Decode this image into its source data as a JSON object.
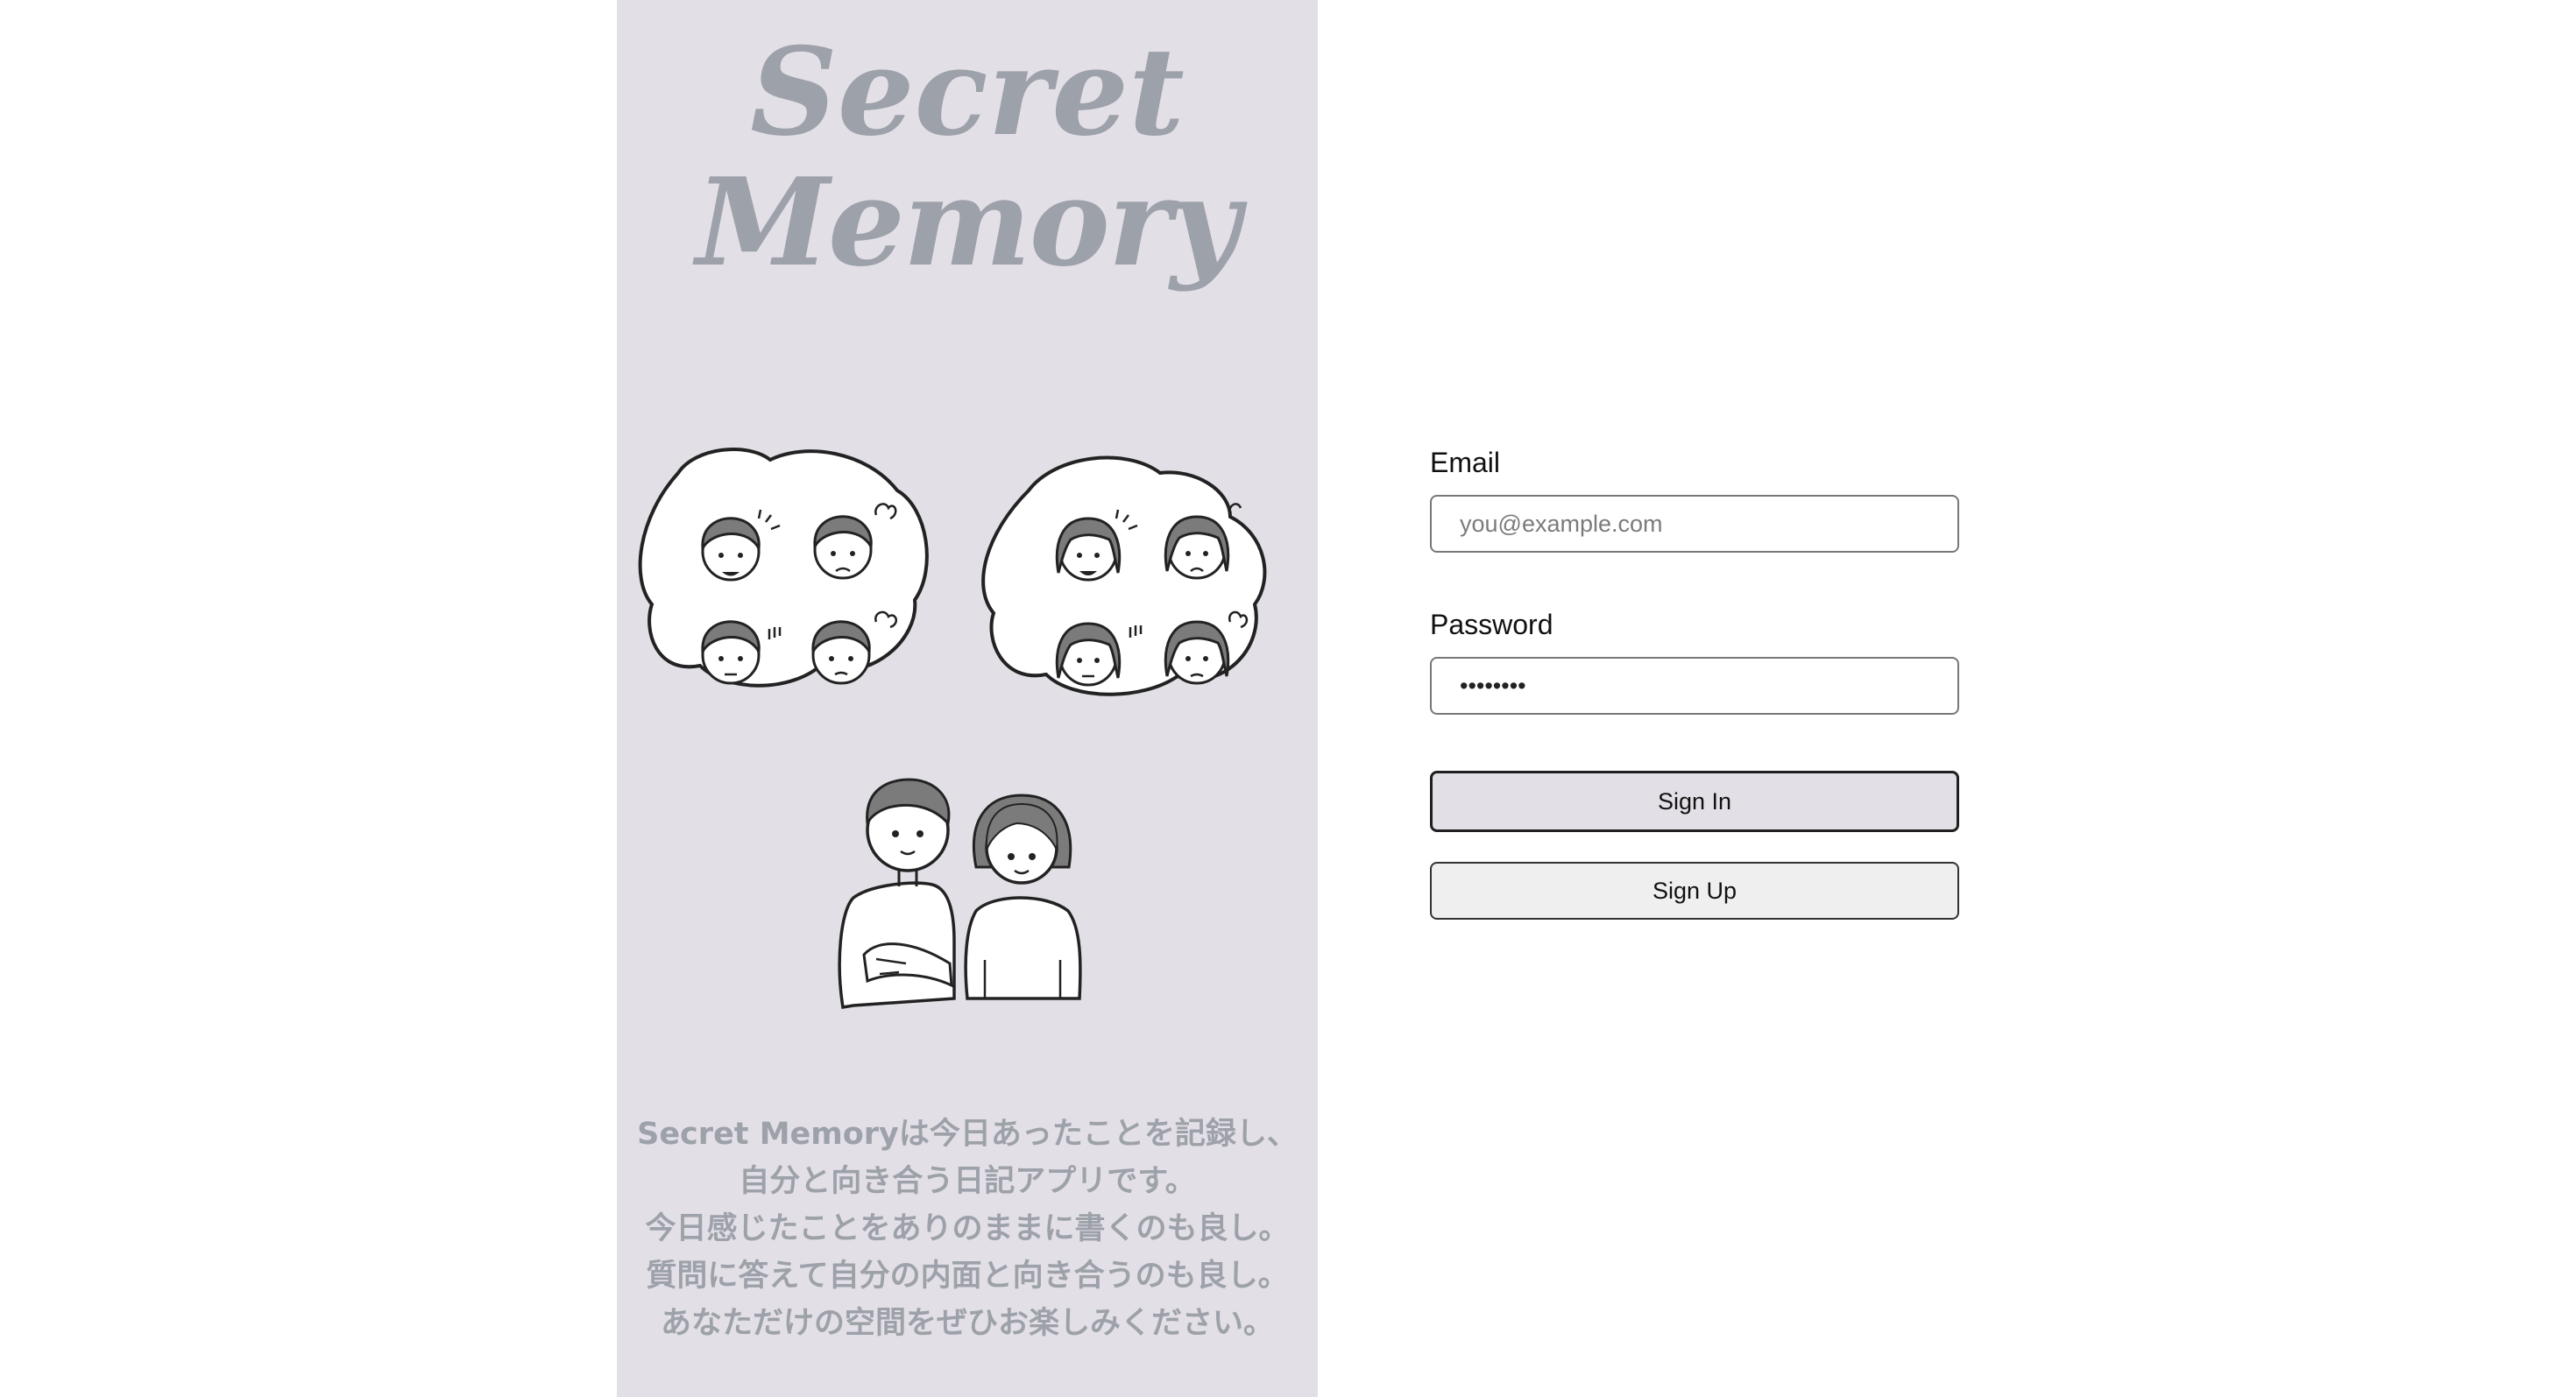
{
  "brand": {
    "title_line1": "Secret",
    "title_line2": "Memory",
    "panel_color": "#e3dfe6",
    "text_color": "#9da1aa"
  },
  "illustration": {
    "subject": "two people with thought bubbles showing emotion faces"
  },
  "description": {
    "lines": [
      "Secret Memoryは今日あったことを記録し、",
      "自分と向き合う日記アプリです。",
      "今日感じたことをありのままに書くのも良し。",
      "質問に答えて自分の内面と向き合うのも良し。",
      "あなただけの空間をぜひお楽しみください。"
    ]
  },
  "form": {
    "email_label": "Email",
    "email_placeholder": "you@example.com",
    "email_value": "",
    "password_label": "Password",
    "password_value": "••••••••",
    "signin_label": "Sign In",
    "signup_label": "Sign Up"
  }
}
